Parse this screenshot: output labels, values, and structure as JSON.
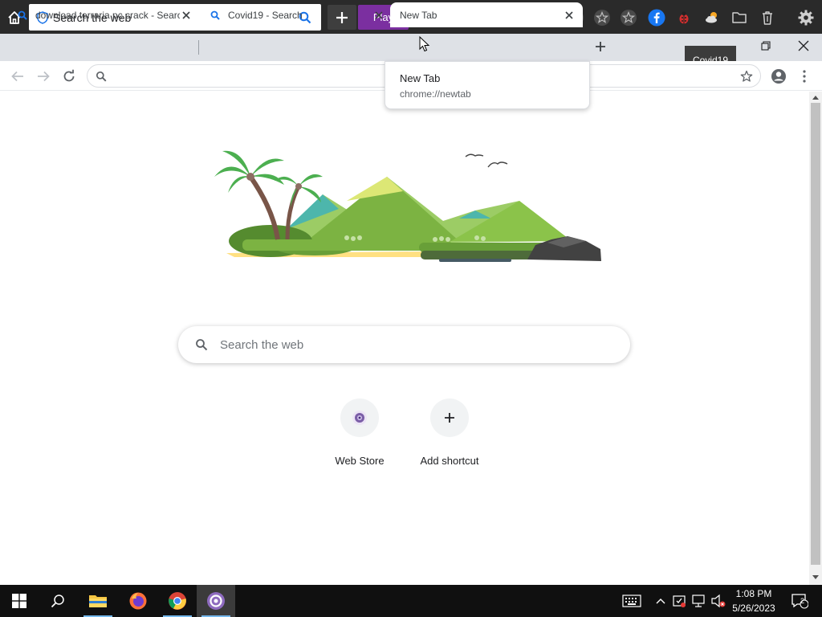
{
  "topbar": {
    "search_label": "Search the web",
    "play_label": "Play",
    "icons": [
      "home-icon",
      "shield-icon",
      "search-icon",
      "plus-icon",
      "star-icon",
      "star-icon",
      "star-icon",
      "star-icon",
      "star-icon",
      "facebook-icon",
      "ladybug-icon",
      "weather-icon",
      "folder-icon",
      "trash-icon",
      "gear-icon"
    ]
  },
  "tabs": [
    {
      "title": "download terraria pc crack - Search"
    },
    {
      "title": "Covid19 - Search"
    },
    {
      "title": "New Tab"
    }
  ],
  "tooltip": "Covid19",
  "hovercard": {
    "title": "New Tab",
    "url": "chrome://newtab"
  },
  "ntp": {
    "search_placeholder": "Search the web",
    "shortcuts": [
      {
        "label": "Web Store"
      },
      {
        "label": "Add shortcut"
      }
    ]
  },
  "taskbar": {
    "time": "1:08 PM",
    "date": "5/26/2023",
    "notification_count": "2"
  },
  "colors": {
    "accent_purple": "#7b2fa0",
    "topbar_bg": "#2a2a2a",
    "tabstrip_bg": "#dee1e6"
  }
}
